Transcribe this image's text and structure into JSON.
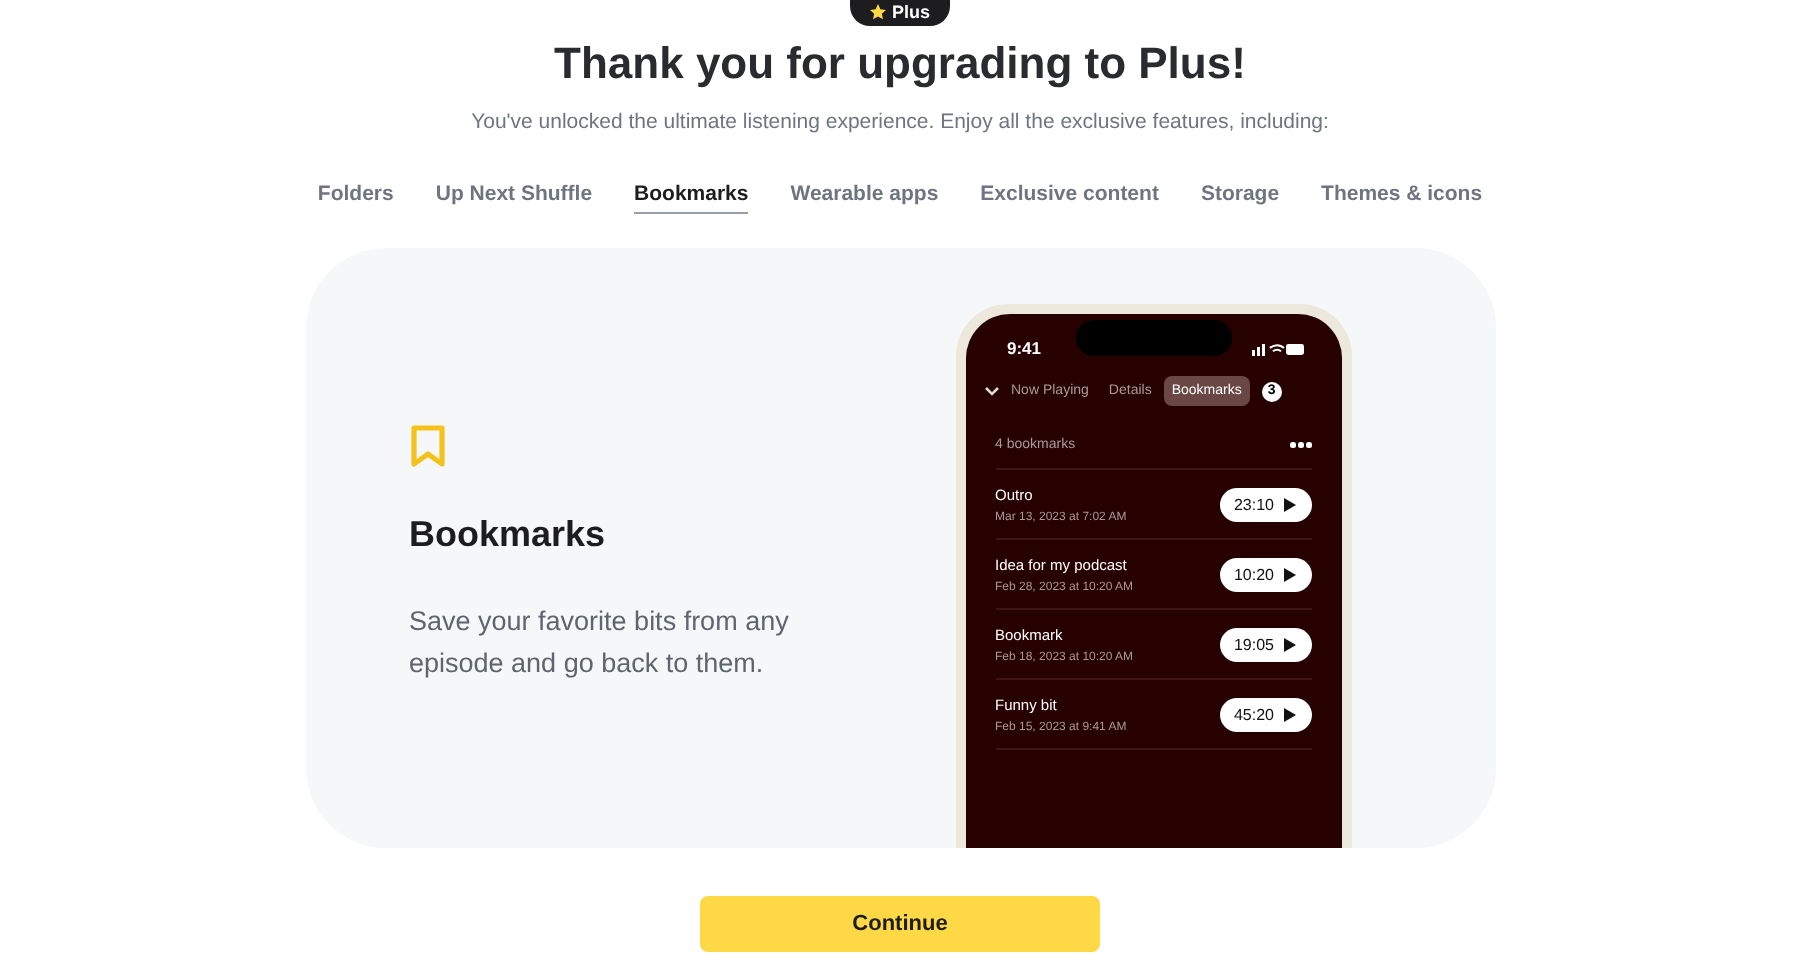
{
  "badge": {
    "label": "Plus"
  },
  "title": "Thank you for upgrading to Plus!",
  "subtitle": "You've unlocked the ultimate listening experience. Enjoy all the exclusive features, including:",
  "tabs": [
    {
      "label": "Folders",
      "selected": false
    },
    {
      "label": "Up Next Shuffle",
      "selected": false
    },
    {
      "label": "Bookmarks",
      "selected": true
    },
    {
      "label": "Wearable apps",
      "selected": false
    },
    {
      "label": "Exclusive content",
      "selected": false
    },
    {
      "label": "Storage",
      "selected": false
    },
    {
      "label": "Themes & icons",
      "selected": false
    }
  ],
  "feature": {
    "title": "Bookmarks",
    "description": "Save your favorite bits from any episode and go back to them."
  },
  "phone": {
    "time": "9:41",
    "queue_count": "3",
    "tabs": [
      {
        "label": "Now Playing",
        "selected": false
      },
      {
        "label": "Details",
        "selected": false
      },
      {
        "label": "Bookmarks",
        "selected": true
      }
    ],
    "count": "4 bookmarks",
    "bookmarks": [
      {
        "title": "Outro",
        "date": "Mar 13, 2023 at 7:02 AM",
        "time": "23:10"
      },
      {
        "title": "Idea for my podcast",
        "date": "Feb 28, 2023 at 10:20 AM",
        "time": "10:20"
      },
      {
        "title": "Bookmark",
        "date": "Feb 18, 2023 at 10:20 AM",
        "time": "19:05"
      },
      {
        "title": "Funny bit",
        "date": "Feb 15, 2023 at 9:41 AM",
        "time": "45:20"
      }
    ]
  },
  "continue_button": "Continue"
}
